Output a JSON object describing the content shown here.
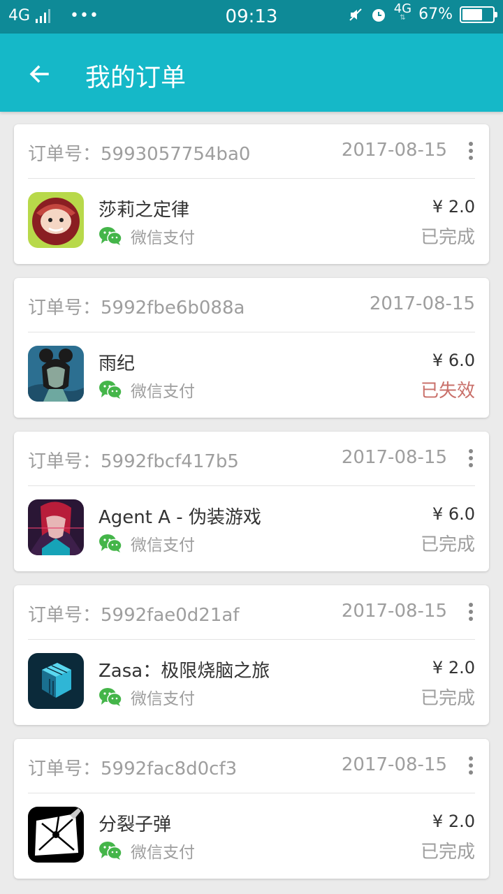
{
  "status_bar": {
    "network": "4G",
    "time": "09:13",
    "network_right": "4G",
    "battery": "67%",
    "battery_level": 0.67
  },
  "app_bar": {
    "title": "我的订单"
  },
  "orders": [
    {
      "order_label": "订单号：",
      "order_no": "5993057754ba0",
      "date": "2017-08-15",
      "has_menu": true,
      "app_name": "莎莉之定律",
      "pay_method": "微信支付",
      "price": "¥ 2.0",
      "status": "已完成",
      "status_type": "done"
    },
    {
      "order_label": "订单号：",
      "order_no": "5992fbe6b088a",
      "date": "2017-08-15",
      "has_menu": false,
      "app_name": "雨纪",
      "pay_method": "微信支付",
      "price": "¥ 6.0",
      "status": "已失效",
      "status_type": "expired"
    },
    {
      "order_label": "订单号：",
      "order_no": "5992fbcf417b5",
      "date": "2017-08-15",
      "has_menu": true,
      "app_name": "Agent A - 伪装游戏",
      "pay_method": "微信支付",
      "price": "¥ 6.0",
      "status": "已完成",
      "status_type": "done"
    },
    {
      "order_label": "订单号：",
      "order_no": "5992fae0d21af",
      "date": "2017-08-15",
      "has_menu": true,
      "app_name": "Zasa：极限烧脑之旅",
      "pay_method": "微信支付",
      "price": "¥ 2.0",
      "status": "已完成",
      "status_type": "done"
    },
    {
      "order_label": "订单号：",
      "order_no": "5992fac8d0cf3",
      "date": "2017-08-15",
      "has_menu": true,
      "app_name": "分裂子弹",
      "pay_method": "微信支付",
      "price": "¥ 2.0",
      "status": "已完成",
      "status_type": "done"
    }
  ],
  "colors": {
    "status_bar": "#0e8a97",
    "app_bar": "#15b8c8",
    "wechat_green": "#44b549",
    "expired": "#c9706a"
  },
  "icons": {
    "back": "arrow-left-icon",
    "more": "more-vertical-icon",
    "pay": "wechat-icon"
  }
}
